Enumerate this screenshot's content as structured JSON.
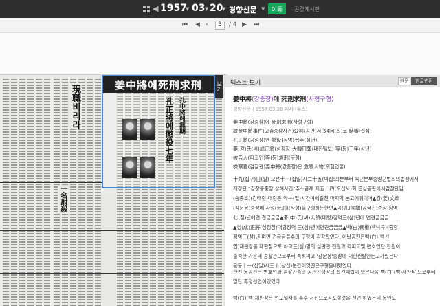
{
  "topbar": {
    "year": "1957",
    "month": "03",
    "day": "20",
    "paper": "경향신문",
    "go_label": "이동",
    "share_label": "공감게시판"
  },
  "pagebar": {
    "current_page": "3",
    "total_pages": "/ 4"
  },
  "newspaper": {
    "selected_headline": "姜中將에死刑求刑",
    "headlines": [
      "孔中將에無期",
      "孔正將에懲役七年",
      "現職비리라",
      "一名射殺"
    ]
  },
  "side_tab": "보기",
  "panel": {
    "header_title": "텍스트 보기",
    "original_label": "원문",
    "hangul_label": "한글변환",
    "article_title_main": "姜中將",
    "article_title_reading": "(강중장)",
    "article_title_mid": "에 死刑求刑",
    "article_title_end": "(사형구형)",
    "meta": "경향신문 | 1957.03.20  기사 (뉴스)",
    "summary": [
      "姜中將(강중장)에 死刑求刑(사형구형)",
      "故金中將事件(고김중장사건)公判(공판)서(54回(회)로 結審(결심)",
      "孔正將(공정장)엔 懲役(징역)七年(칠년)",
      "姜(강)氏(씨)成正將(성정장)大韓日報(대한일보) 等(등)三年(삼년)",
      "被告人(피고인)等(등)求刑(구형)",
      "檢察官(검찰관)姜中將(강중장)은 危險人物(위험인물)"
    ],
    "para1": [
      "十九(십구)日(일) 오전十一(십일)시二十五(이십오)분부터 육군본부중앙군법회의법정에서",
      "개정된 \"김창룡중장 살해사건\"추소공재 제五十四(오십사)회 결심공판에서검찰관임",
      "(송종호)(김태령)대령은 약一(일)시간여에걸친 마지막 논고에뒤이어▲강(姜)文奉",
      "(강문봉)중장에 사형(死刑)(사형)을구형하는한편▲공(孔)國鎭(공국진)준장 징역",
      "七(칠)년에면 견금금금▲중(中)氏(씨)大領(대령)징역三(삼)년에 면견금금금",
      "▲성(成)正將(성정장)대령징역 三(삼)년에면견금금금▲백(白)南權(백낙규)(중령)",
      "징역三(삼)년 며면 견금금불수의 구형이 각각있었다. 이날공판은백(白)(백선",
      "엽)재판장을 재판장으로 하고三(삼)명의 심판관 전원과 각피고및 변호인단 전원이",
      "출석한 가운데 검찰관으로부터 특히피고 '강문봉'중장에 대한신랄한논고가있은다",
      "음동十一(십일)시三十(삼십)분간이엇결은구형을내렸었다"
    ],
    "para2": "한편 동공판은 변호인과 검찰관측의 공판진행상의 의견때립이 있은다음 백(白)(백)재판장 으로부터 일단 휴정선언이있었다",
    "para3": "백(白)(백)재판장은 언도일자를 추후 서신으로공포할것을 선언 하였는데 동언도"
  },
  "colors": {
    "topbar_bg": "#2e2e2e",
    "go_button": "#19a85e",
    "selection_border": "#4a86c8",
    "highlight_text": "#7a3db8"
  }
}
